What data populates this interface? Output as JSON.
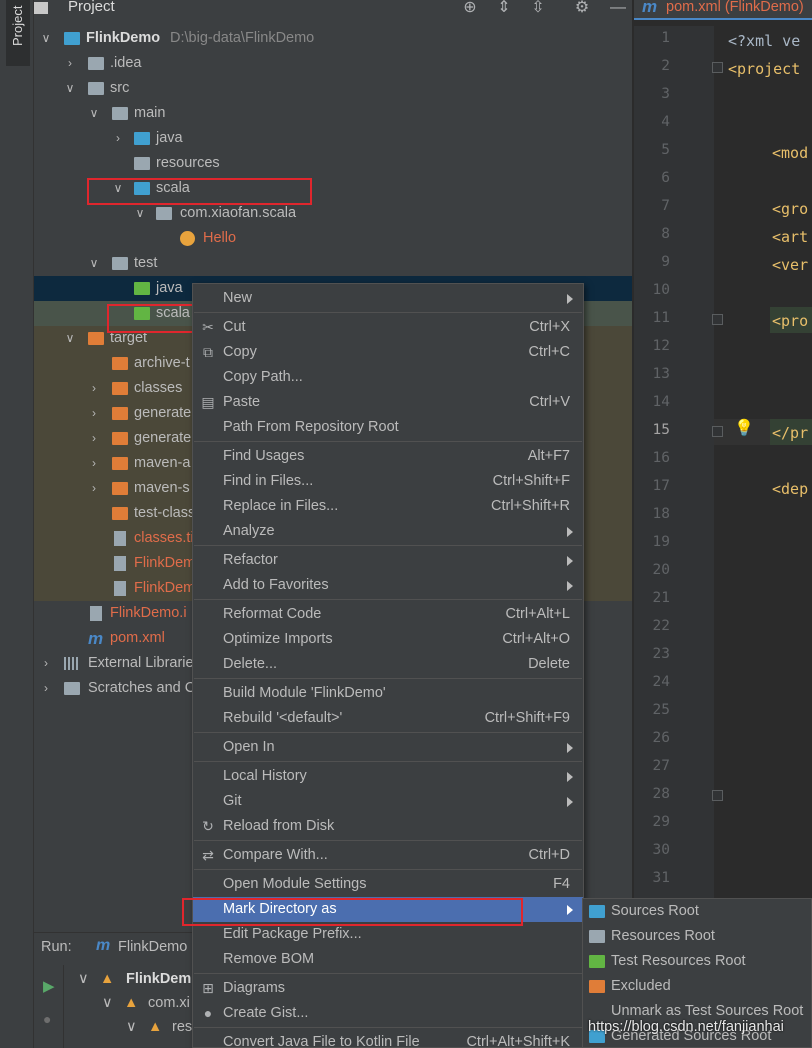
{
  "stripe": {
    "tab_label": "Project"
  },
  "project": {
    "header_title": "Project",
    "tree": [
      {
        "label": "FlinkDemo",
        "hint": "D:\\big-data\\FlinkDemo"
      },
      {
        "label": ".idea"
      },
      {
        "label": "src"
      },
      {
        "label": "main"
      },
      {
        "label": "java"
      },
      {
        "label": "resources"
      },
      {
        "label": "scala"
      },
      {
        "label": "com.xiaofan.scala"
      },
      {
        "label": "Hello"
      },
      {
        "label": "test"
      },
      {
        "label": "java"
      },
      {
        "label": "scala"
      },
      {
        "label": "target"
      },
      {
        "label": "archive-t"
      },
      {
        "label": "classes"
      },
      {
        "label": "generate"
      },
      {
        "label": "generate"
      },
      {
        "label": "maven-a"
      },
      {
        "label": "maven-s"
      },
      {
        "label": "test-class"
      },
      {
        "label": "classes.ti"
      },
      {
        "label": "FlinkDem"
      },
      {
        "label": "FlinkDem"
      },
      {
        "label": "FlinkDemo.i"
      },
      {
        "label": "pom.xml"
      },
      {
        "label": "External Librarie"
      },
      {
        "label": "Scratches and C"
      }
    ]
  },
  "editor": {
    "tab_label": "pom.xml (FlinkDemo)",
    "lines": [
      "1",
      "2",
      "3",
      "4",
      "5",
      "6",
      "7",
      "8",
      "9",
      "10",
      "11",
      "12",
      "13",
      "14",
      "15",
      "16",
      "17",
      "18",
      "19",
      "20",
      "21",
      "22",
      "23",
      "24",
      "25",
      "26",
      "27",
      "28",
      "29",
      "30",
      "31"
    ],
    "code": {
      "l1": "<?xml ve",
      "l2": "<project",
      "l5": "<mod",
      "l7": "<gro",
      "l8": "<art",
      "l9": "<ver",
      "l11": "<pro",
      "l15": "</pr",
      "l17": "<dep"
    }
  },
  "run": {
    "label": "Run:",
    "tab": "FlinkDemo",
    "rows": [
      "FlinkDem",
      "com.xi",
      "rese"
    ]
  },
  "context_menu": {
    "items": [
      {
        "label": "New",
        "shortcut": ""
      },
      {
        "label": "Cut",
        "shortcut": "Ctrl+X"
      },
      {
        "label": "Copy",
        "shortcut": "Ctrl+C"
      },
      {
        "label": "Copy Path...",
        "shortcut": ""
      },
      {
        "label": "Paste",
        "shortcut": "Ctrl+V"
      },
      {
        "label": "Path From Repository Root",
        "shortcut": ""
      },
      {
        "label": "Find Usages",
        "shortcut": "Alt+F7"
      },
      {
        "label": "Find in Files...",
        "shortcut": "Ctrl+Shift+F"
      },
      {
        "label": "Replace in Files...",
        "shortcut": "Ctrl+Shift+R"
      },
      {
        "label": "Analyze",
        "shortcut": ""
      },
      {
        "label": "Refactor",
        "shortcut": ""
      },
      {
        "label": "Add to Favorites",
        "shortcut": ""
      },
      {
        "label": "Reformat Code",
        "shortcut": "Ctrl+Alt+L"
      },
      {
        "label": "Optimize Imports",
        "shortcut": "Ctrl+Alt+O"
      },
      {
        "label": "Delete...",
        "shortcut": "Delete"
      },
      {
        "label": "Build Module 'FlinkDemo'",
        "shortcut": ""
      },
      {
        "label": "Rebuild '<default>'",
        "shortcut": "Ctrl+Shift+F9"
      },
      {
        "label": "Open In",
        "shortcut": ""
      },
      {
        "label": "Local History",
        "shortcut": ""
      },
      {
        "label": "Git",
        "shortcut": ""
      },
      {
        "label": "Reload from Disk",
        "shortcut": ""
      },
      {
        "label": "Compare With...",
        "shortcut": "Ctrl+D"
      },
      {
        "label": "Open Module Settings",
        "shortcut": "F4"
      },
      {
        "label": "Mark Directory as",
        "shortcut": ""
      },
      {
        "label": "Edit Package Prefix...",
        "shortcut": ""
      },
      {
        "label": "Remove BOM",
        "shortcut": ""
      },
      {
        "label": "Diagrams",
        "shortcut": ""
      },
      {
        "label": "Create Gist...",
        "shortcut": ""
      },
      {
        "label": "Convert Java File to Kotlin File",
        "shortcut": "Ctrl+Alt+Shift+K"
      }
    ]
  },
  "submenu": {
    "items": [
      "Sources Root",
      "Resources Root",
      "Test Resources Root",
      "Excluded",
      "Unmark as Test Sources Root",
      "Generated Sources Root"
    ]
  },
  "watermark": "https://blog.csdn.net/fanjianhai",
  "colors": {
    "selection": "#4b6eaf",
    "highlight_box": "#e0262d",
    "test_folder": "#62b543",
    "source_folder": "#40a0d0",
    "excluded_folder": "#e07d38"
  }
}
